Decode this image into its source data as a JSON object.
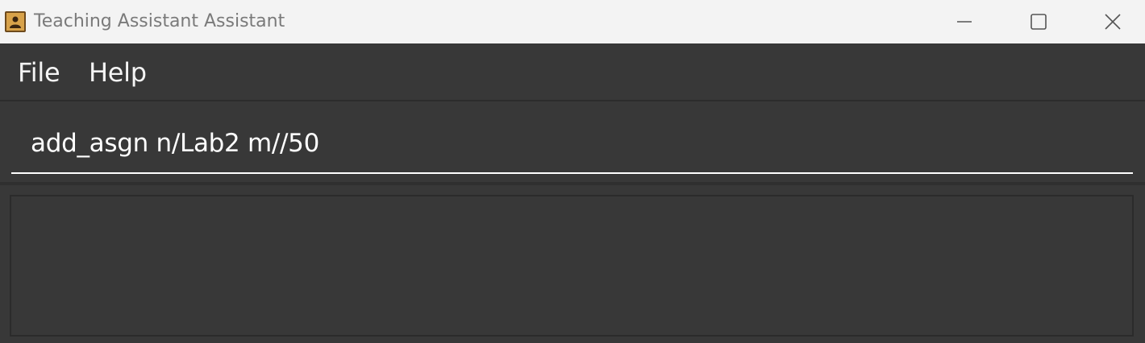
{
  "window": {
    "title": "Teaching Assistant Assistant",
    "app_icon": "contact-book-icon",
    "controls": [
      "minimize-icon",
      "maximize-icon",
      "close-icon"
    ]
  },
  "menu": {
    "items": [
      {
        "label": "File"
      },
      {
        "label": "Help"
      }
    ]
  },
  "command_box": {
    "value": "add_asgn n/Lab2 m//50",
    "placeholder": ""
  },
  "result_display": {
    "text": ""
  },
  "colors": {
    "titlebar_bg": "#f3f3f3",
    "app_bg": "#383838",
    "text": "#ffffff",
    "title_text": "#7a7a7a",
    "input_underline": "#ffffff"
  }
}
